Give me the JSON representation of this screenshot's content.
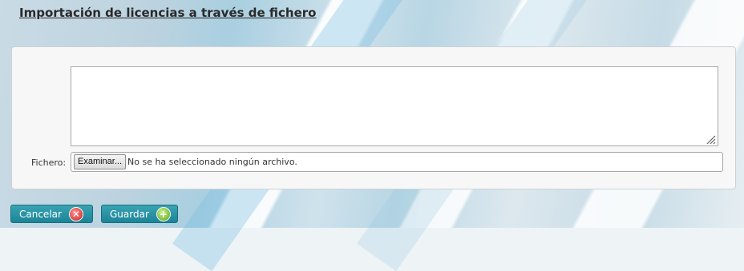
{
  "page": {
    "title": "Importación de licencias a través de fichero"
  },
  "form": {
    "textarea_value": "",
    "file_label": "Fichero:",
    "browse_label": "Examinar...",
    "file_status": "No se ha seleccionado ningún archivo."
  },
  "actions": {
    "cancel_label": "Cancelar",
    "cancel_icon": "cancel-x-icon",
    "save_label": "Guardar",
    "save_icon": "plus-icon"
  },
  "colors": {
    "button_bg": "#1b8598",
    "cancel_icon": "#d41f1f",
    "save_icon": "#5aa61a"
  }
}
